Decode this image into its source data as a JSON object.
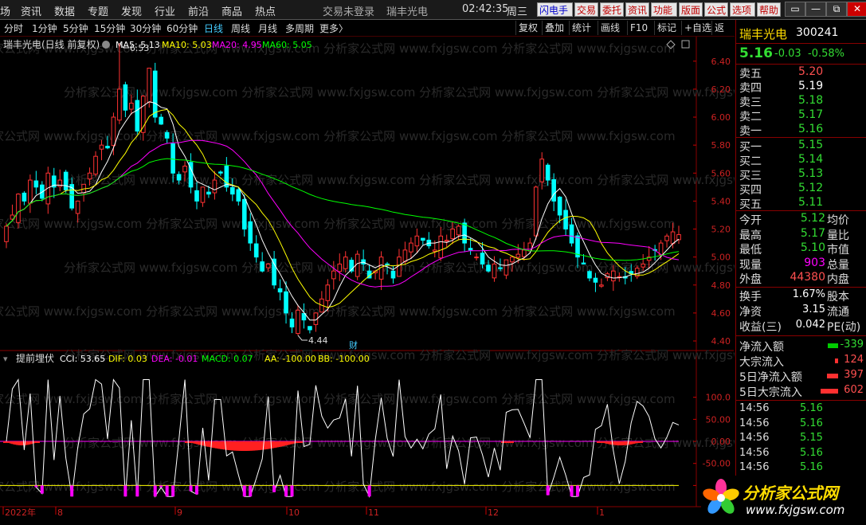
{
  "menu": {
    "items": [
      "场",
      "资讯",
      "数据",
      "专题",
      "发现",
      "行业",
      "前沿",
      "商品",
      "热点"
    ],
    "status_login": "交易未登录",
    "stock_name": "瑞丰光电",
    "clock": "02:42:35",
    "weekday": "周三",
    "buttons": [
      "闪电手",
      "交易",
      "委托",
      "资讯",
      "功能",
      "版面",
      "公式",
      "选项",
      "帮助"
    ],
    "win_controls": [
      "▭",
      "—",
      "⧉",
      "✕"
    ]
  },
  "period_bar": {
    "items": [
      "分时",
      "1分钟",
      "5分钟",
      "15分钟",
      "30分钟",
      "60分钟",
      "日线",
      "周线",
      "月线",
      "多周期",
      "更多〉"
    ],
    "active": "日线",
    "tools": [
      "复权",
      "叠加",
      "统计",
      "画线",
      "F10",
      "标记",
      "+自选",
      "返回"
    ]
  },
  "main_chart": {
    "title": "瑞丰光电(日线 前复权)",
    "ma_labels": [
      {
        "text": "MA5: 5.13",
        "color": "#ffffff"
      },
      {
        "text": "MA10: 5.03",
        "color": "#ffff00"
      },
      {
        "text": "MA20: 4.95",
        "color": "#ff00ff"
      },
      {
        "text": "MA60: 5.05",
        "color": "#00ff00"
      }
    ],
    "y_ticks": [
      "6.40",
      "6.20",
      "6.00",
      "5.80",
      "5.60",
      "5.40",
      "5.20",
      "5.00",
      "4.80",
      "4.60",
      "4.40"
    ],
    "high_marker": "6.53",
    "low_marker": "4.44",
    "event_marker": "财",
    "watermark": "分析家公式网 www.fxjgsw.com"
  },
  "indicator": {
    "name": "提前埋伏",
    "labels": [
      {
        "text": "CCI: 53.65",
        "color": "#ffffff"
      },
      {
        "text": "DIF: 0.03",
        "color": "#ffff00"
      },
      {
        "text": "DEA: -0.01",
        "color": "#ff00ff"
      },
      {
        "text": "MACD: 0.07",
        "color": "#00ff00"
      },
      {
        "text": "AA: -100.00",
        "color": "#ffff00"
      },
      {
        "text": "BB: -100.00",
        "color": "#ffff00"
      }
    ],
    "y_ticks": [
      "100.0",
      "50.00",
      "0.00",
      "-50.00",
      "-100.0"
    ]
  },
  "x_axis": {
    "labels": [
      "2022年",
      "8",
      "9",
      "10",
      "11",
      "12",
      "1"
    ]
  },
  "quote": {
    "name": "瑞丰光电",
    "code": "300241",
    "price": "5.16",
    "change": "-0.03",
    "change_pct": "-0.58%",
    "asks": [
      {
        "label": "卖五",
        "price": "5.20",
        "color": "#ff5050"
      },
      {
        "label": "卖四",
        "price": "5.19",
        "color": "#ffffff"
      },
      {
        "label": "卖三",
        "price": "5.18",
        "color": "#33dd33"
      },
      {
        "label": "卖二",
        "price": "5.17",
        "color": "#33dd33"
      },
      {
        "label": "卖一",
        "price": "5.16",
        "color": "#33dd33"
      }
    ],
    "bids": [
      {
        "label": "买一",
        "price": "5.15",
        "color": "#33dd33"
      },
      {
        "label": "买二",
        "price": "5.14",
        "color": "#33dd33"
      },
      {
        "label": "买三",
        "price": "5.13",
        "color": "#33dd33"
      },
      {
        "label": "买四",
        "price": "5.12",
        "color": "#33dd33"
      },
      {
        "label": "买五",
        "price": "5.11",
        "color": "#33dd33"
      }
    ],
    "stats": [
      {
        "label": "今开",
        "value": "5.12",
        "color": "#33dd33",
        "label2": "均价"
      },
      {
        "label": "最高",
        "value": "5.17",
        "color": "#33dd33",
        "label2": "量比"
      },
      {
        "label": "最低",
        "value": "5.10",
        "color": "#33dd33",
        "label2": "市值"
      },
      {
        "label": "现量",
        "value": "903",
        "color": "#ff00ff",
        "label2": "总量"
      },
      {
        "label": "外盘",
        "value": "44380",
        "color": "#ff5050",
        "label2": "内盘"
      }
    ],
    "stats2": [
      {
        "label": "换手",
        "value": "1.67%",
        "color": "#ffffff",
        "label2": "股本"
      },
      {
        "label": "净资",
        "value": "3.15",
        "color": "#ffffff",
        "label2": "流通"
      },
      {
        "label": "收益(三)",
        "value": "0.042",
        "color": "#ffffff",
        "label2": "PE(动)"
      }
    ],
    "flows": [
      {
        "label": "净流入额",
        "value": "-339",
        "color": "#33dd33",
        "bar": "green",
        "bar_frac": 0.35
      },
      {
        "label": "大宗流入",
        "value": "124",
        "color": "#ff5050",
        "bar": "red",
        "bar_frac": 0.1
      },
      {
        "label": "5日净流入额",
        "value": "397",
        "color": "#ff5050",
        "bar": "red",
        "bar_frac": 0.4
      },
      {
        "label": "5日大宗流入",
        "value": "602",
        "color": "#ff5050",
        "bar": "red",
        "bar_frac": 0.6
      }
    ],
    "ticks": [
      {
        "time": "14:56",
        "price": "5.16"
      },
      {
        "time": "14:56",
        "price": "5.16"
      },
      {
        "time": "14:56",
        "price": "5.15"
      },
      {
        "time": "14:56",
        "price": "5.16"
      },
      {
        "time": "14:56",
        "price": "5.16"
      }
    ]
  },
  "logo": {
    "text": "分析家公式网",
    "url_text": "www.fxjgsw.com"
  },
  "colors": {
    "up": "#ff3232",
    "down": "#00ffff",
    "ma5": "#ffffff",
    "ma10": "#ffff00",
    "ma20": "#ff00ff",
    "ma60": "#00ff00"
  },
  "chart_data": {
    "type": "candlestick",
    "y_range": [
      4.4,
      6.45
    ],
    "closes": [
      5.22,
      5.3,
      5.45,
      5.4,
      5.55,
      5.5,
      5.42,
      5.6,
      5.5,
      5.55,
      5.48,
      5.35,
      5.4,
      5.52,
      5.6,
      5.72,
      5.8,
      5.78,
      6.0,
      6.2,
      6.05,
      6.1,
      5.9,
      6.15,
      6.35,
      6.0,
      5.95,
      5.85,
      5.6,
      5.55,
      5.65,
      5.5,
      5.4,
      5.5,
      5.45,
      5.55,
      5.6,
      5.5,
      5.45,
      5.4,
      5.2,
      5.1,
      5.0,
      4.9,
      4.95,
      4.8,
      4.75,
      4.6,
      4.5,
      4.62,
      4.55,
      4.48,
      4.6,
      4.7,
      4.8,
      4.9,
      4.95,
      5.0,
      4.9,
      5.02,
      4.95,
      4.85,
      4.9,
      5.0,
      4.95,
      4.85,
      5.0,
      5.05,
      5.1,
      5.15,
      5.12,
      5.08,
      5.05,
      5.15,
      5.12,
      5.2,
      5.22,
      5.1,
      5.05,
      5.0,
      4.95,
      4.9,
      4.95,
      4.92,
      4.98,
      5.0,
      5.02,
      5.05,
      5.1,
      5.5,
      5.7,
      5.55,
      5.4,
      5.3,
      5.2,
      5.1,
      5.0,
      4.95,
      4.85,
      4.82,
      4.8,
      4.88,
      4.9,
      4.86,
      4.85,
      4.88,
      4.92,
      4.95,
      5.0,
      5.05,
      5.1,
      5.15,
      5.18,
      5.16
    ]
  }
}
